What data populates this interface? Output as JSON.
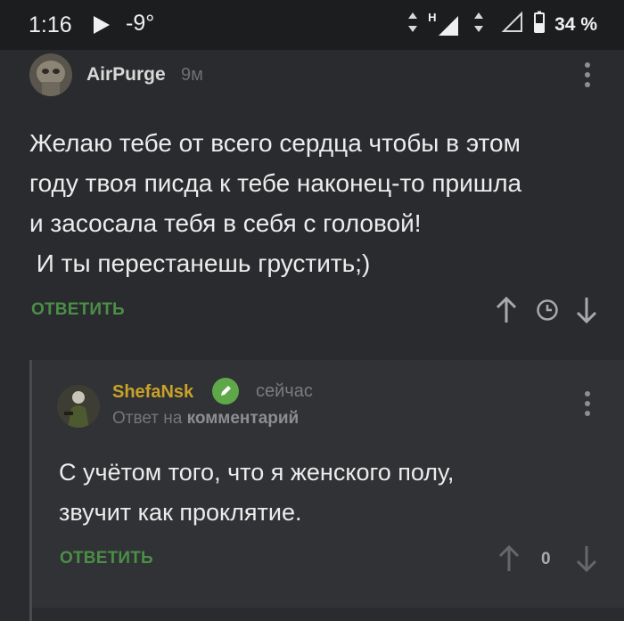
{
  "status_bar": {
    "time": "1:16",
    "temperature": "-9°",
    "network_label": "H",
    "battery": "34 %"
  },
  "comment": {
    "author": "AirPurge",
    "time": "9м",
    "lines": [
      "Желаю тебе от всего сердца чтобы в этом",
      "году твоя писда к тебе наконец-то пришла",
      "и засосала тебя в себя с головой!",
      " И ты перестанешь грустить;)"
    ],
    "reply_label": "ОТВЕТИТЬ"
  },
  "reply": {
    "author": "ShefaNsk",
    "time": "сейчас",
    "reply_to_prefix": "Ответ на",
    "reply_to_target": "комментарий",
    "lines": [
      "С учётом того, что я женского полу,",
      "звучит как проклятие."
    ],
    "reply_label": "ОТВЕТИТЬ",
    "vote_count": "0"
  },
  "colors": {
    "background": "#2a2b2e",
    "reply_background": "#313235",
    "accent_green": "#4b8f47",
    "author_gold": "#c9a228"
  }
}
